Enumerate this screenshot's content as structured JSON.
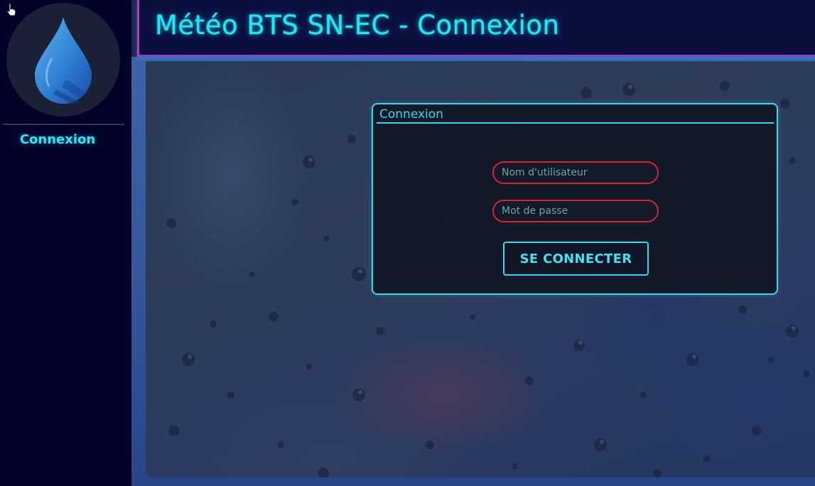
{
  "header": {
    "title": "Météo BTS SN-EC - Connexion"
  },
  "sidebar": {
    "logo_icon": "water-drop-icon",
    "items": [
      {
        "label": "Connexion",
        "active": true
      }
    ]
  },
  "login": {
    "legend": "Connexion",
    "username": {
      "placeholder": "Nom d'utilisateur",
      "value": ""
    },
    "password": {
      "placeholder": "Mot de passe",
      "value": ""
    },
    "submit_label": "SE CONNECTER"
  },
  "colors": {
    "accent_cyan": "#38d6e6",
    "sidebar_bg": "#03032a",
    "header_bg": "#0b0f3d",
    "header_border_magenta": "#c331c4",
    "input_border_red": "#d8232c"
  }
}
